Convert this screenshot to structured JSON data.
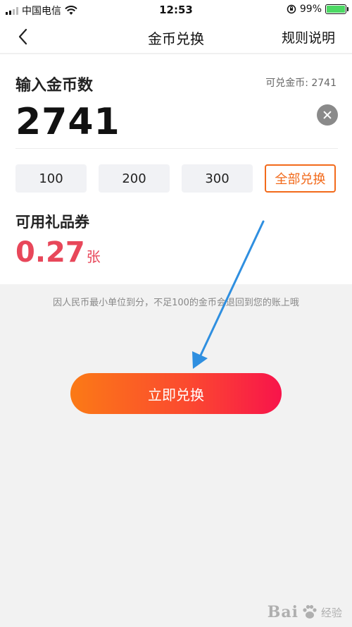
{
  "status_bar": {
    "carrier": "中国电信",
    "time": "12:53",
    "battery_percent": "99%",
    "battery_level": 0.99
  },
  "nav": {
    "back_icon": "chevron-left-icon",
    "title": "金币兑换",
    "rules_link": "规则说明"
  },
  "exchange": {
    "input_label": "输入金币数",
    "available_label": "可兑金币: 2741",
    "amount": "2741",
    "quick_amounts": [
      {
        "label": "100",
        "selected": false
      },
      {
        "label": "200",
        "selected": false
      },
      {
        "label": "300",
        "selected": false
      },
      {
        "label": "全部兑换",
        "selected": true
      }
    ]
  },
  "voucher": {
    "label": "可用礼品券",
    "value": "0.27",
    "unit": "张"
  },
  "notice": "因人民币最小单位到分，不足100的金币会退回到您的账上哦",
  "submit_button": "立即兑换",
  "colors": {
    "accent_orange": "#f26a1b",
    "voucher_red": "#e8475a",
    "button_gradient_start": "#fb7a16",
    "button_gradient_end": "#f8144b",
    "annotation_arrow": "#2f8fe0"
  },
  "watermark": {
    "brand": "Bai",
    "brand_suffix": "经验"
  }
}
